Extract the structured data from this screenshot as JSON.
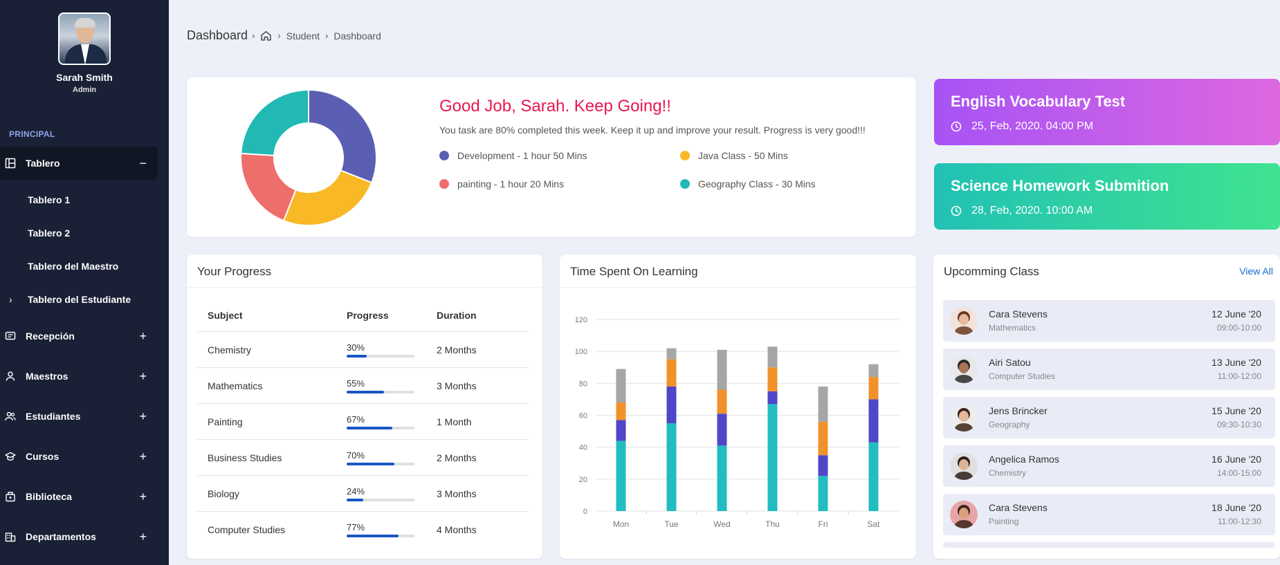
{
  "profile": {
    "name": "Sarah Smith",
    "role": "Admin"
  },
  "sidebar": {
    "section": "PRINCIPAL",
    "active": {
      "label": "Tablero",
      "sign": "−"
    },
    "sub_items": [
      "Tablero 1",
      "Tablero 2",
      "Tablero del Maestro",
      "Tablero del Estudiante"
    ],
    "sub_chevron": "›",
    "items": [
      {
        "label": "Recepción",
        "icon": "reception-icon",
        "sign": "+"
      },
      {
        "label": "Maestros",
        "icon": "user-icon",
        "sign": "+"
      },
      {
        "label": "Estudiantes",
        "icon": "users-icon",
        "sign": "+"
      },
      {
        "label": "Cursos",
        "icon": "graduation-cap-icon",
        "sign": "+"
      },
      {
        "label": "Biblioteca",
        "icon": "library-icon",
        "sign": "+"
      },
      {
        "label": "Departamentos",
        "icon": "building-icon",
        "sign": "+"
      }
    ]
  },
  "breadcrumb": {
    "title": "Dashboard",
    "sep": "›",
    "items": [
      "Student",
      "Dashboard"
    ]
  },
  "greeting": {
    "title": "Good Job, Sarah. Keep Going!!",
    "desc": "You task are 80% completed this week. Keep it up and improve your result. Progress is very good!!!",
    "legend": [
      {
        "label": "Development - 1 hour 50 Mins",
        "color": "#5b5fb3"
      },
      {
        "label": "Java Class - 50 Mins",
        "color": "#f9b826"
      },
      {
        "label": "painting - 1 hour 20 Mins",
        "color": "#ee6e6c"
      },
      {
        "label": "Geography Class - 30 Mins",
        "color": "#22b9b5"
      }
    ],
    "donut": [
      {
        "value": 31,
        "color": "#5b5fb3"
      },
      {
        "value": 25,
        "color": "#f9b826"
      },
      {
        "value": 20,
        "color": "#ee6e6c"
      },
      {
        "value": 24,
        "color": "#22b9b5"
      }
    ]
  },
  "events": [
    {
      "title": "English Vocabulary Test",
      "time": "25, Feb, 2020. 04:00 PM"
    },
    {
      "title": "Science Homework Submition",
      "time": "28, Feb, 2020. 10:00 AM"
    }
  ],
  "progress": {
    "title": "Your Progress",
    "headers": [
      "Subject",
      "Progress",
      "Duration"
    ],
    "rows": [
      {
        "subject": "Chemistry",
        "pct": "30%",
        "value": 30,
        "duration": "2 Months"
      },
      {
        "subject": "Mathematics",
        "pct": "55%",
        "value": 55,
        "duration": "3 Months"
      },
      {
        "subject": "Painting",
        "pct": "67%",
        "value": 67,
        "duration": "1 Month"
      },
      {
        "subject": "Business Studies",
        "pct": "70%",
        "value": 70,
        "duration": "2 Months"
      },
      {
        "subject": "Biology",
        "pct": "24%",
        "value": 24,
        "duration": "3 Months"
      },
      {
        "subject": "Computer Studies",
        "pct": "77%",
        "value": 77,
        "duration": "4 Months"
      }
    ]
  },
  "time_card": {
    "title": "Time Spent On Learning"
  },
  "chart_data": {
    "type": "bar",
    "stacked": true,
    "categories": [
      "Mon",
      "Tue",
      "Wed",
      "Thu",
      "Fri",
      "Sat"
    ],
    "ylim": [
      0,
      120
    ],
    "yticks": [
      "0",
      "20",
      "40",
      "60",
      "80",
      "100",
      "120"
    ],
    "grid": true,
    "series": [
      {
        "color": "#22bdc0",
        "values": [
          44,
          55,
          41,
          67,
          22,
          43
        ]
      },
      {
        "color": "#5046c8",
        "values": [
          13,
          23,
          20,
          8,
          13,
          27
        ]
      },
      {
        "color": "#f0922a",
        "values": [
          11,
          17,
          15,
          15,
          21,
          14
        ]
      },
      {
        "color": "#a6a6a6",
        "values": [
          21,
          7,
          25,
          13,
          22,
          8
        ]
      }
    ]
  },
  "upcoming": {
    "title": "Upcomming Class",
    "view_all": "View All",
    "items": [
      {
        "name": "Cara Stevens",
        "subject": "Mathematics",
        "date": "12 June '20",
        "time": "09:00-10:00",
        "bg": "#f3e2da",
        "skin": "#e8b9a0",
        "hair": "#6b3a22"
      },
      {
        "name": "Airi Satou",
        "subject": "Computer Studies",
        "date": "13 June '20",
        "time": "11:00-12:00",
        "bg": "#e8e8e8",
        "skin": "#a87556",
        "hair": "#2a2a2a"
      },
      {
        "name": "Jens Brincker",
        "subject": "Geography",
        "date": "15 June '20",
        "time": "09:30-10:30",
        "bg": "#ededed",
        "skin": "#e4b99c",
        "hair": "#3a2418"
      },
      {
        "name": "Angelica Ramos",
        "subject": "Chemistry",
        "date": "16 June '20",
        "time": "14:00-15:00",
        "bg": "#e0e0e0",
        "skin": "#deb395",
        "hair": "#2b1f18"
      },
      {
        "name": "Cara Stevens",
        "subject": "Painting",
        "date": "18 June '20",
        "time": "11:00-12:30",
        "bg": "#e8a4a8",
        "skin": "#d9a07c",
        "hair": "#3b2418"
      }
    ]
  }
}
